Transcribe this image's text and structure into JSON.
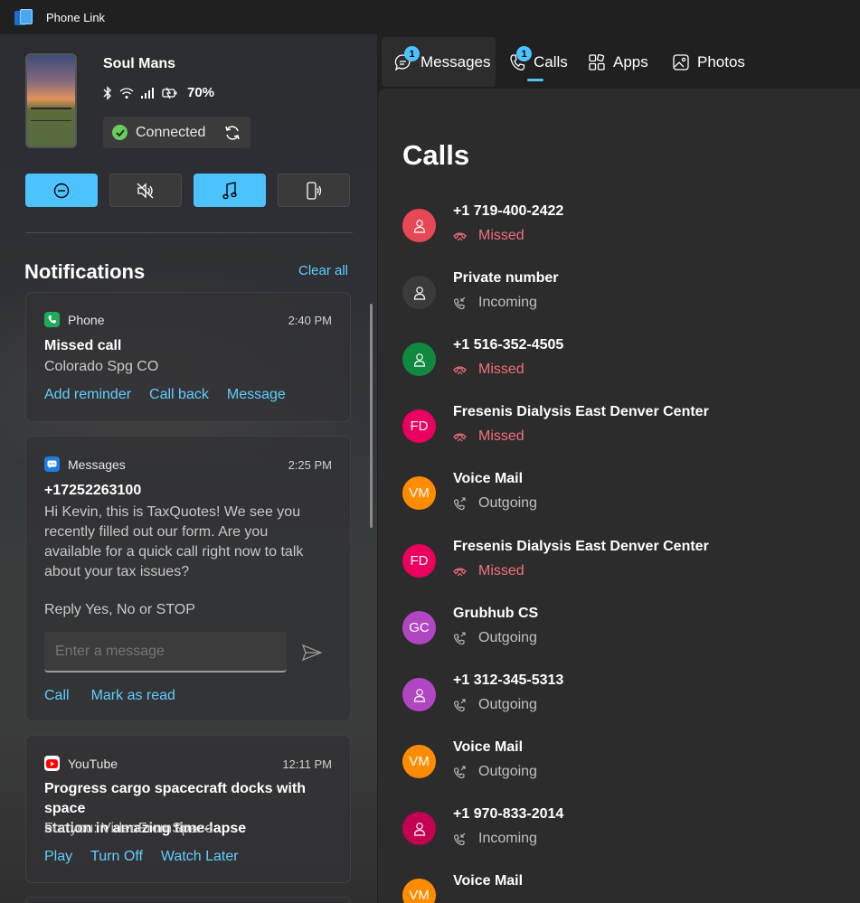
{
  "window": {
    "title": "Phone Link"
  },
  "device": {
    "name": "Soul Mans",
    "battery": "70%",
    "connection": "Connected"
  },
  "notifications": {
    "header": "Notifications",
    "clear_all": "Clear all",
    "items": [
      {
        "app": "Phone",
        "time": "2:40 PM",
        "title": "Missed call",
        "body": "Colorado Spg CO",
        "actions": [
          "Add reminder",
          "Call back",
          "Message"
        ]
      },
      {
        "app": "Messages",
        "time": "2:25 PM",
        "title": "+17252263100",
        "body_lines": [
          "Hi Kevin, this is TaxQuotes! We see you",
          "recently filled out our form. Are you",
          "available for a quick call right now to talk",
          "about your tax issues?"
        ],
        "footer": "Reply Yes, No or STOP",
        "input_placeholder": "Enter a message",
        "actions": [
          "Call",
          "Mark as read"
        ]
      },
      {
        "app": "YouTube",
        "time": "12:11 PM",
        "title_lines": [
          "Progress cargo spacecraft docks with space",
          "station in amazing time-lapse"
        ],
        "body": "For you: VideoFromSpace",
        "actions": [
          "Play",
          "Turn Off",
          "Watch Later"
        ]
      }
    ]
  },
  "tabs": [
    {
      "label": "Messages",
      "badge": "1",
      "selected": true
    },
    {
      "label": "Calls",
      "badge": "1",
      "selected": false
    },
    {
      "label": "Apps"
    },
    {
      "label": "Photos"
    }
  ],
  "calls": {
    "title": "Calls",
    "items": [
      {
        "name": "+1 719-400-2422",
        "status": "Missed",
        "avatar": "",
        "color": "#e74856"
      },
      {
        "name": "Private number",
        "status": "Incoming",
        "avatar": "",
        "color": "#3b3b3b"
      },
      {
        "name": "+1 516-352-4505",
        "status": "Missed",
        "avatar": "",
        "color": "#10893e"
      },
      {
        "name": "Fresenis Dialysis East Denver Center",
        "status": "Missed",
        "avatar": "FD",
        "color": "#ea005e"
      },
      {
        "name": "Voice Mail",
        "status": "Outgoing",
        "avatar": "VM",
        "color": "#ff8c00"
      },
      {
        "name": "Fresenis Dialysis East Denver Center",
        "status": "Missed",
        "avatar": "FD",
        "color": "#ea005e"
      },
      {
        "name": "Grubhub CS",
        "status": "Outgoing",
        "avatar": "GC",
        "color": "#b146c2"
      },
      {
        "name": "+1 312-345-5313",
        "status": "Outgoing",
        "avatar": "",
        "color": "#b146c2"
      },
      {
        "name": "Voice Mail",
        "status": "Outgoing",
        "avatar": "VM",
        "color": "#ff8c00"
      },
      {
        "name": "+1 970-833-2014",
        "status": "Incoming",
        "avatar": "",
        "color": "#c30052"
      },
      {
        "name": "Voice Mail",
        "status": "",
        "avatar": "VM",
        "color": "#ff8c00"
      }
    ]
  },
  "colors": {
    "accent": "#4cc2ff",
    "link": "#60cdff",
    "missed": "#f1707b"
  }
}
